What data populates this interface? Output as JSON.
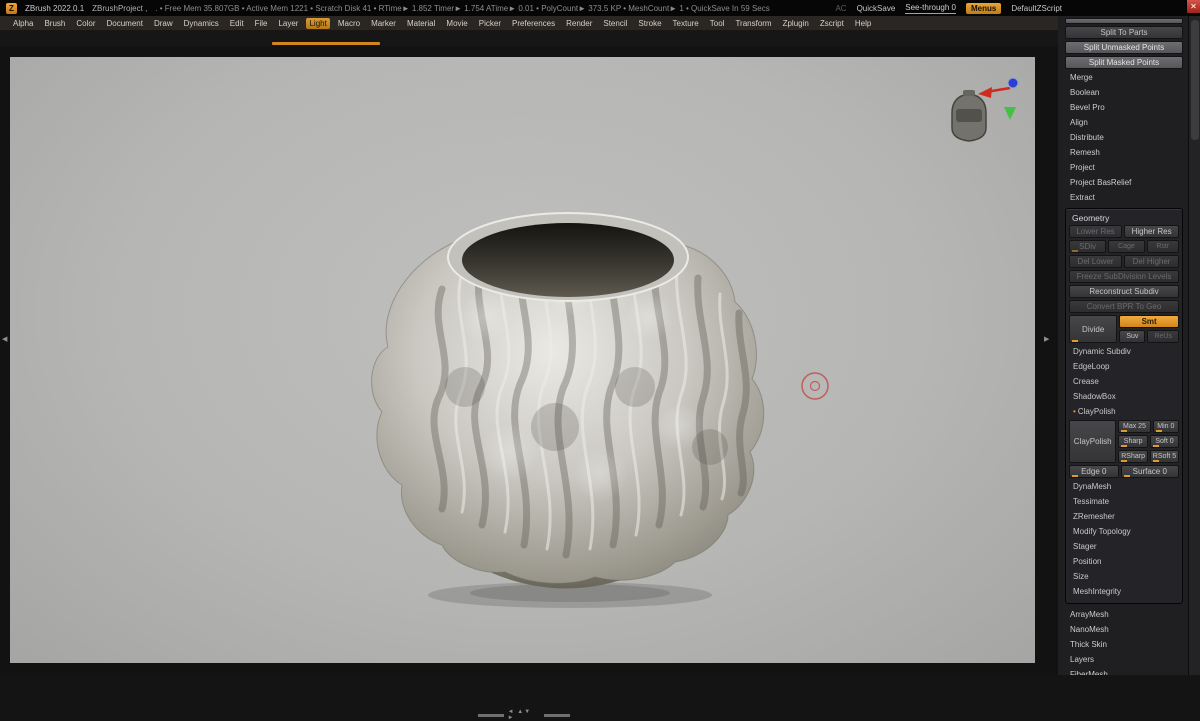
{
  "ui_colors": {
    "accent_orange": "#e09a2d",
    "canvas_gray": "#b6b6b4",
    "panel_bg": "#1f1f21"
  },
  "titlebar": {
    "logo_letter": "Z",
    "title": "ZBrush 2022.0.1",
    "project": "ZBrushProject ,",
    "stats": ". • Free Mem 35.807GB • Active Mem 1221 • Scratch Disk 41 • RTime► 1.852 Timer► 1.754 ATime► 0.01 • PolyCount► 373.5 KP • MeshCount► 1 • QuickSave In 59 Secs",
    "ac": "AC",
    "quicksave": "QuickSave",
    "see_through": "See-through  0",
    "menus": "Menus",
    "default_zscript": "DefaultZScript",
    "close": "✕"
  },
  "menubar": {
    "items": [
      {
        "label": "Alpha",
        "style": ""
      },
      {
        "label": "Brush",
        "style": ""
      },
      {
        "label": "Color",
        "style": ""
      },
      {
        "label": "Document",
        "style": ""
      },
      {
        "label": "Draw",
        "style": ""
      },
      {
        "label": "Dynamics",
        "style": ""
      },
      {
        "label": "Edit",
        "style": ""
      },
      {
        "label": "File",
        "style": ""
      },
      {
        "label": "Layer",
        "style": ""
      },
      {
        "label": "Light",
        "style": "active"
      },
      {
        "label": "Macro",
        "style": ""
      },
      {
        "label": "Marker",
        "style": ""
      },
      {
        "label": "Material",
        "style": ""
      },
      {
        "label": "Movie",
        "style": ""
      },
      {
        "label": "Picker",
        "style": ""
      },
      {
        "label": "Preferences",
        "style": ""
      },
      {
        "label": "Render",
        "style": ""
      },
      {
        "label": "Stencil",
        "style": ""
      },
      {
        "label": "Stroke",
        "style": ""
      },
      {
        "label": "Texture",
        "style": ""
      },
      {
        "label": "Tool",
        "style": ""
      },
      {
        "label": "Transform",
        "style": ""
      },
      {
        "label": "Zplugin",
        "style": ""
      },
      {
        "label": "Zscript",
        "style": ""
      },
      {
        "label": "Help",
        "style": ""
      }
    ],
    "active": "Light"
  },
  "tool_panel": {
    "top_buttons": [
      {
        "label": "Split To Parts",
        "style": "normal"
      },
      {
        "label": "Split Unmasked Points",
        "style": "raised"
      },
      {
        "label": "Split Masked Points",
        "style": "raised"
      },
      {
        "label": "Merge",
        "style": "header"
      },
      {
        "label": "Boolean",
        "style": "header"
      },
      {
        "label": "Bevel Pro",
        "style": "header"
      },
      {
        "label": "Align",
        "style": "header"
      },
      {
        "label": "Distribute",
        "style": "header"
      },
      {
        "label": "Remesh",
        "style": "header"
      },
      {
        "label": "Project",
        "style": "header"
      },
      {
        "label": "Project BasRelief",
        "style": "header"
      },
      {
        "label": "Extract",
        "style": "header"
      }
    ],
    "geometry": {
      "header": "Geometry",
      "lower_res": "Lower Res",
      "higher_res": "Higher Res",
      "sdiv": "SDiv",
      "cage": "Cage",
      "rstr": "Rstr",
      "del_lower": "Del Lower",
      "del_higher": "Del Higher",
      "freeze": "Freeze SubDivision Levels",
      "reconstruct": "Reconstruct Subdiv",
      "convert_bpr": "Convert BPR To Geo",
      "divide": "Divide",
      "smt": "Smt",
      "suv": "Suv",
      "reus": "ReUs",
      "mid_headers": [
        "Dynamic Subdiv",
        "EdgeLoop",
        "Crease",
        "ShadowBox"
      ],
      "claypolish_bullet": "•",
      "claypolish_header": "ClayPolish",
      "claypolish_button": "ClayPolish",
      "max": "Max 25",
      "min": "Min 0",
      "sharp": "Sharp",
      "soft": "Soft 0",
      "rsharp": "RSharp",
      "rsoft": "RSoft 5",
      "edge": "Edge 0",
      "surface": "Surface 0",
      "bottom_headers": [
        "DynaMesh",
        "Tessimate",
        "ZRemesher",
        "Modify Topology",
        "Stager",
        "Position",
        "Size",
        "MeshIntegrity"
      ]
    },
    "bottom_buttons": [
      "ArrayMesh",
      "NanoMesh",
      "Thick Skin",
      "Layers",
      "FiberMesh"
    ]
  }
}
